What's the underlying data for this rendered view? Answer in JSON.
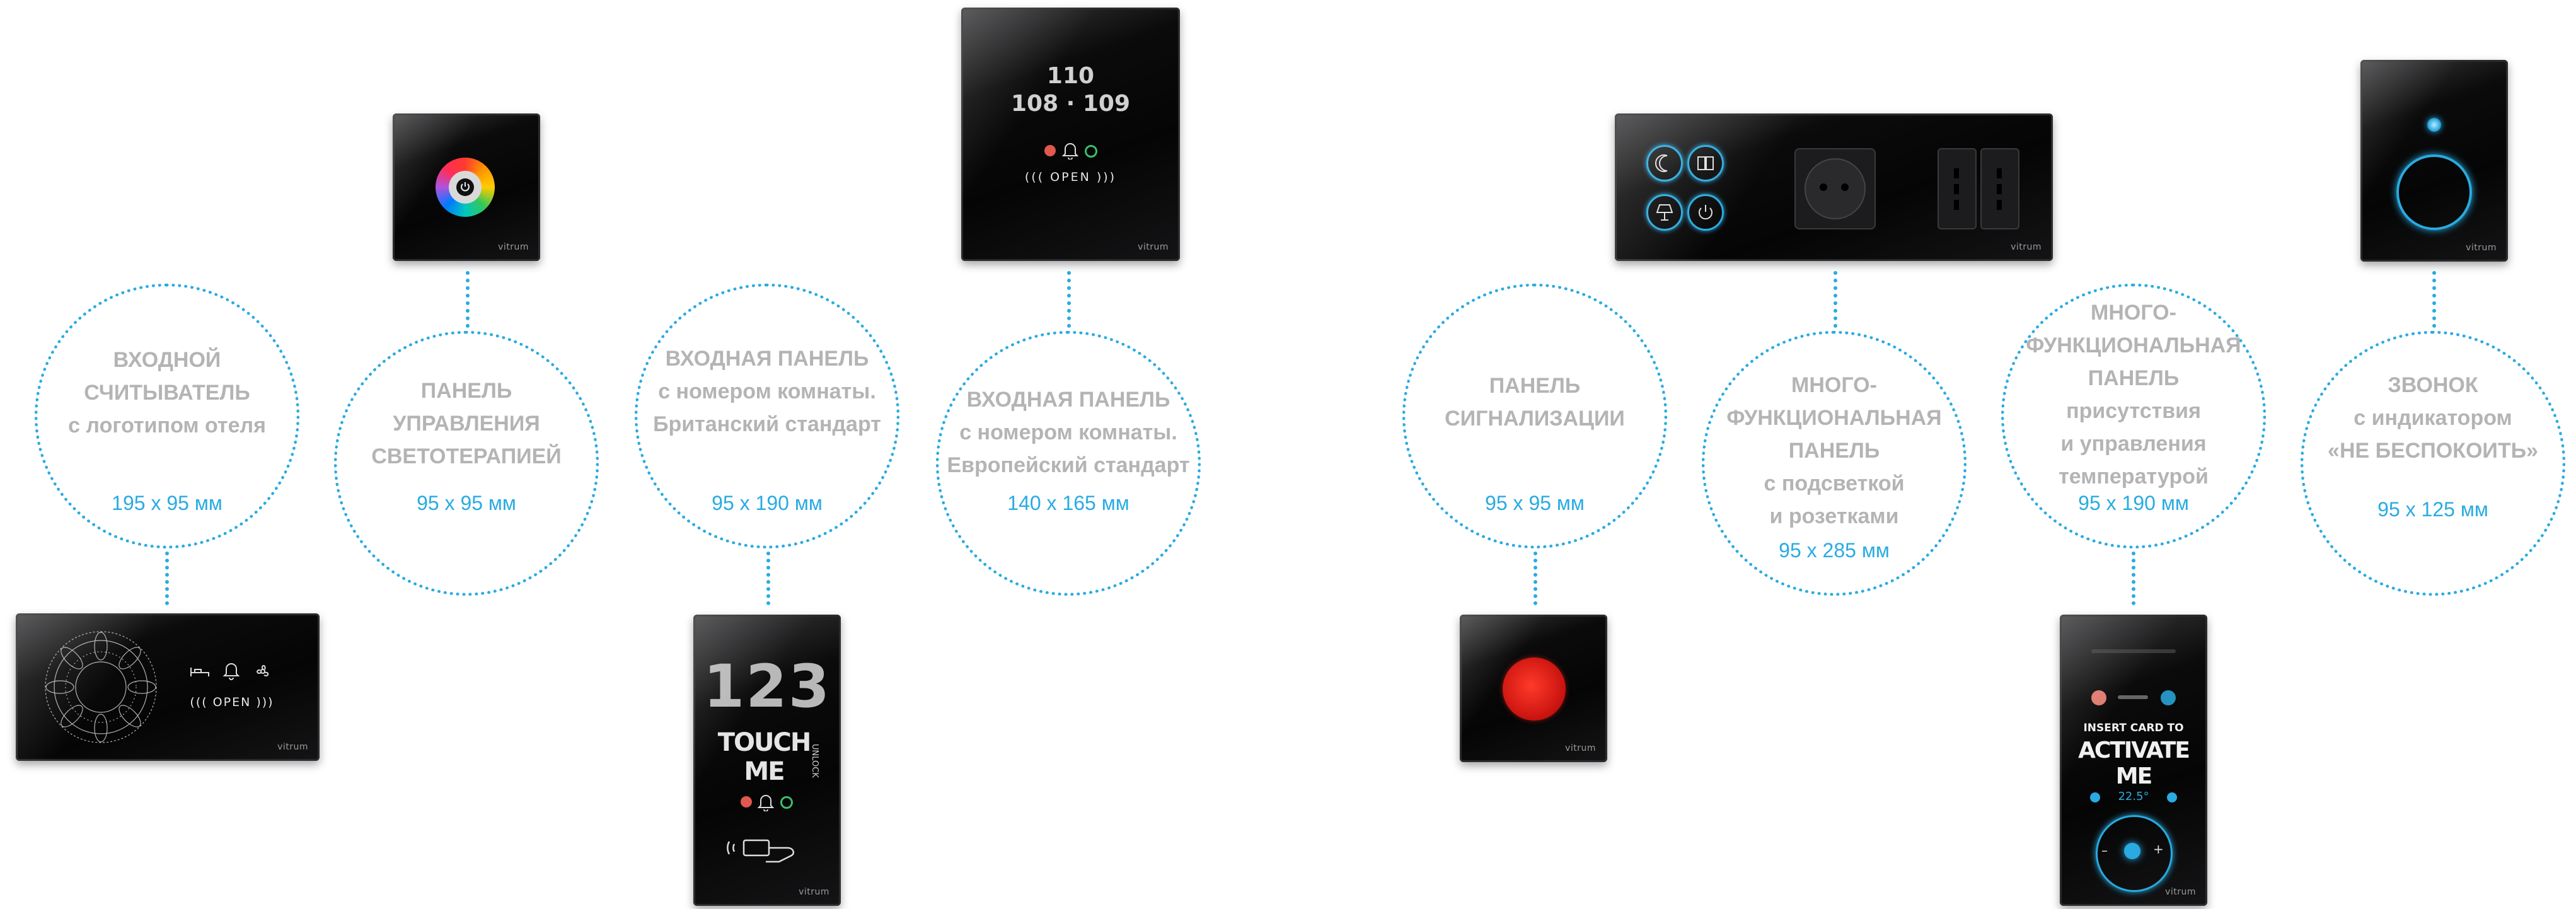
{
  "items": [
    {
      "label": [
        "ВХОДНОЙ",
        "СЧИТЫВАТЕЛЬ",
        "с логотипом отеля"
      ],
      "size": "195 х 95 мм"
    },
    {
      "label": [
        "ПАНЕЛЬ",
        "УПРАВЛЕНИЯ",
        "СВЕТОТЕРАПИЕЙ"
      ],
      "size": "95 х 95 мм"
    },
    {
      "label": [
        "ВХОДНАЯ ПАНЕЛЬ",
        "с номером комнаты.",
        "Британский стандарт"
      ],
      "size": "95 х 190 мм"
    },
    {
      "label": [
        "ВХОДНАЯ ПАНЕЛЬ",
        "с номером комнаты.",
        "Европейский стандарт"
      ],
      "size": "140 х 165 мм"
    },
    {
      "label": [
        "ПАНЕЛЬ",
        "СИГНАЛИЗАЦИИ"
      ],
      "size": "95 х 95 мм"
    },
    {
      "label": [
        "МНОГО-",
        "ФУНКЦИОНАЛЬНАЯ",
        "ПАНЕЛЬ",
        "с подсветкой",
        "и розетками"
      ],
      "size": "95 х 285 мм"
    },
    {
      "label": [
        "МНОГО-",
        "ФУНКЦИОНАЛЬНАЯ",
        "ПАНЕЛЬ",
        "присутствия",
        "и управления",
        "температурой"
      ],
      "size": "95 х 190 мм"
    },
    {
      "label": [
        "ЗВОНОК",
        "с индикатором",
        "«НЕ БЕСПОКОИТЬ»"
      ],
      "size": "95 х 125 мм"
    }
  ],
  "panels": {
    "brand": "vitrum",
    "open_label": "((( OPEN )))",
    "room_number_top": "110",
    "room_number_bottom": "108 · 109",
    "room_big": "123",
    "touch_me": "TOUCH ME",
    "unlock": "UNLOCK",
    "insert_card": "INSERT CARD TO",
    "activate_me": "ACTIVATE ME",
    "temp_display": "22.5°"
  },
  "colors": {
    "accent": "#29abe2",
    "label": "#b4b4b4",
    "panel": "#0b0b0c",
    "alarm_red": "#e01e1e"
  }
}
